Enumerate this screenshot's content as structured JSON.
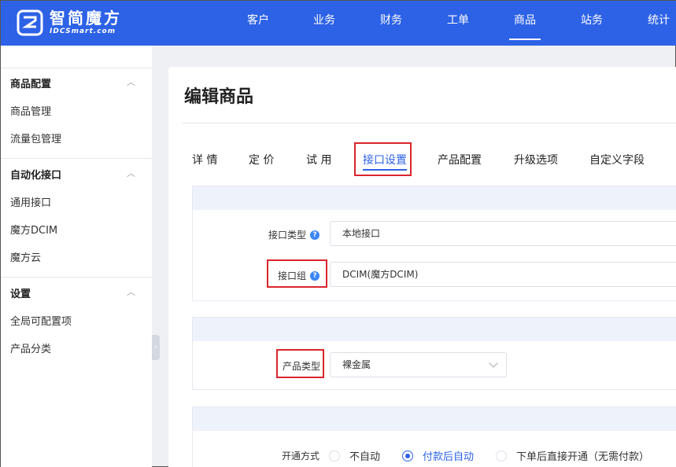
{
  "brand": {
    "name_cn": "智简魔方",
    "name_en": "IDCSmart.com"
  },
  "topnav": [
    {
      "label": "客户",
      "active": false
    },
    {
      "label": "业务",
      "active": false
    },
    {
      "label": "财务",
      "active": false
    },
    {
      "label": "工单",
      "active": false
    },
    {
      "label": "商品",
      "active": true
    },
    {
      "label": "站务",
      "active": false
    },
    {
      "label": "统计",
      "active": false
    }
  ],
  "sidebar": {
    "groups": [
      {
        "title": "商品配置",
        "items": [
          "商品管理",
          "流量包管理"
        ]
      },
      {
        "title": "自动化接口",
        "items": [
          "通用接口",
          "魔方DCIM",
          "魔方云"
        ]
      },
      {
        "title": "设置",
        "items": [
          "全局可配置项",
          "产品分类"
        ]
      }
    ],
    "collapse_glyph": "‹"
  },
  "page": {
    "title": "编辑商品",
    "tabs": [
      {
        "label": "详 情",
        "active": false
      },
      {
        "label": "定 价",
        "active": false
      },
      {
        "label": "试 用",
        "active": false
      },
      {
        "label": "接口设置",
        "active": true
      },
      {
        "label": "产品配置",
        "active": false
      },
      {
        "label": "升级选项",
        "active": false
      },
      {
        "label": "自定义字段",
        "active": false
      }
    ]
  },
  "interface_section": {
    "type_label": "接口类型",
    "type_value": "本地接口",
    "group_label": "接口组",
    "group_value": "DCIM(魔方DCIM)"
  },
  "product_section": {
    "type_label": "产品类型",
    "type_value": "裸金属"
  },
  "provision_section": {
    "label": "开通方式",
    "options": [
      {
        "label": "不自动",
        "checked": false
      },
      {
        "label": "付款后自动",
        "checked": true
      },
      {
        "label": "下单后直接开通（无需付款）",
        "checked": false
      }
    ]
  },
  "colors": {
    "brand_blue": "#2d62e6",
    "highlight_red": "#d9252c"
  }
}
